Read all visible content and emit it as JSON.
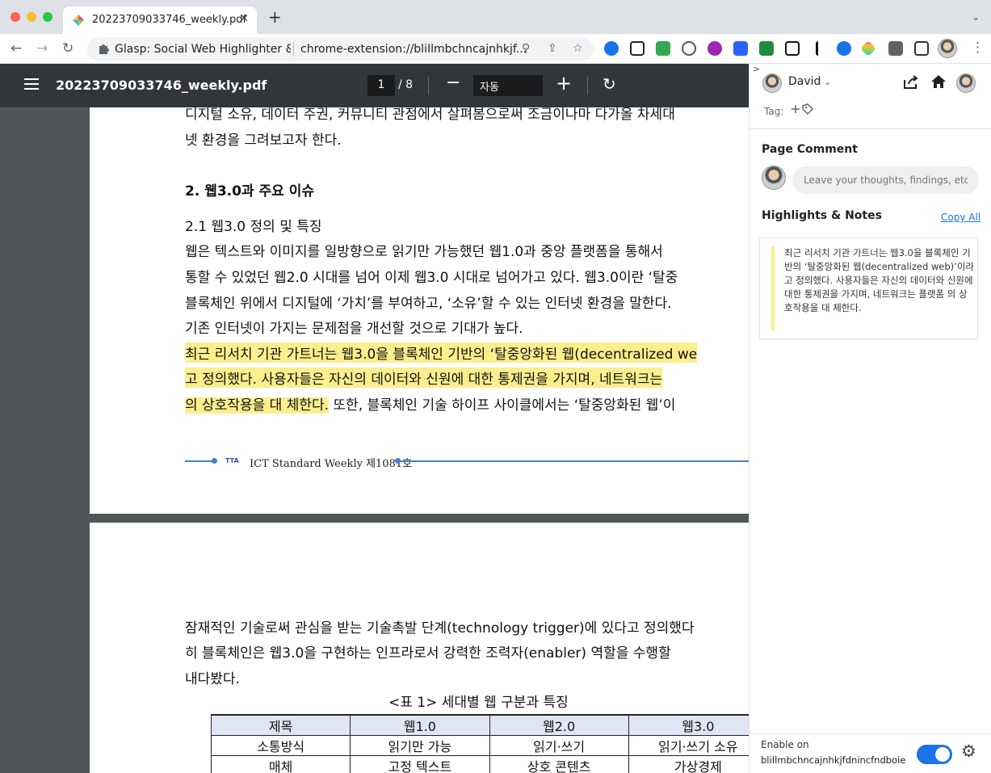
{
  "browser": {
    "tab_title": "20223709033746_weekly.pdf",
    "tab_close": "✕",
    "new_tab": "+",
    "tab_menu": "⌄",
    "omnibox_extension_name": "Glasp: Social Web Highlighter & N",
    "omnibox_url": "chrome-extension://bliIlmbchncajnhkjf...",
    "nav": {
      "back": "←",
      "forward": "→",
      "reload": "↻"
    },
    "omnibox_icons": {
      "search": "⚲",
      "share": "⇪",
      "star": "☆"
    },
    "menu": "⋮"
  },
  "pdf": {
    "title": "20223709033746_weekly.pdf",
    "page_current": "1",
    "page_total": "/ 8",
    "zoom_value": "자동",
    "zoom_minus": "−",
    "zoom_plus": "+",
    "rotate": "↻",
    "page1_lines": [
      "디지털 소유, 데이터 주권, 커뮤니티 관점에서 살펴봄으로써 조금이나마 다가올 차세대",
      "넷 환경을 그려보고자 한다.",
      "2. 웹3.0과 주요 이슈",
      "2.1 웹3.0 정의 및 특징",
      "웹은 텍스트와 이미지를 일방향으로 읽기만 가능했던 웹1.0과 중앙 플랫폼을 통해서",
      "통할 수 있었던 웹2.0 시대를 넘어 이제 웹3.0 시대로 넘어가고 있다. 웹3.0이란 ‘탈중",
      "블록체인 위에서 디지털에 ‘가치’를 부여하고, ‘소유’할 수 있는 인터넷 환경을 말한다.",
      "기존 인터넷이 가지는 문제점을 개선할 것으로 기대가 높다."
    ],
    "highlight_lines": [
      "최근 리서치 기관 가트너는 웹3.0을 블록체인 기반의 ‘탈중앙화된 웹(decentralized we",
      "고 정의했다. 사용자들은 자신의 데이터와 신원에 대한 통제권을 가지며, 네트워크는 ",
      "의 상호작용을 대 체한다."
    ],
    "after_highlight": " 또한, 블록체인 기술 하이프 사이클에서는 ‘탈중앙화된 웹’이",
    "footer_logo": "TTA",
    "footer_text": "ICT Standard Weekly 제1081호",
    "page2_lines": [
      "잠재적인 기술로써 관심을 받는 기술촉발 단계(technology trigger)에 있다고 정의했다",
      "히 블록체인은 웹3.0을 구현하는 인프라로서 강력한 조력자(enabler) 역할을 수행할 ",
      "내다봤다."
    ],
    "table_caption": "<표 1> 세대별 웹 구분과 특징",
    "table": [
      [
        "제목",
        "웹1.0",
        "웹2.0",
        "웹3.0"
      ],
      [
        "소통방식",
        "읽기만 가능",
        "읽기·쓰기",
        "읽기·쓰기 소유"
      ],
      [
        "매체",
        "고정 텍스트",
        "상호 콘텐츠",
        "가상경제"
      ]
    ]
  },
  "glasp": {
    "user_name": "David",
    "tag_label": "Tag:",
    "page_comment_title": "Page Comment",
    "comment_placeholder": "Leave your thoughts, findings, etc",
    "highlights_title": "Highlights & Notes",
    "copy_all": "Copy All",
    "note_text": "최근 리서치 기관 가트너는 웹3.0을 블록체인 기반의 ‘탈중앙화된 웹(decentralized web)’이라 고 정의했다. 사용자들은 자신의 데이터와 신원에 대한 통제권을 가지며, 네트워크는 플랫폼 의 상호작용을 대 체한다.",
    "enable_label": "Enable on",
    "enable_id": "bliIlmbchncajnhkjfdnincfndboie"
  }
}
